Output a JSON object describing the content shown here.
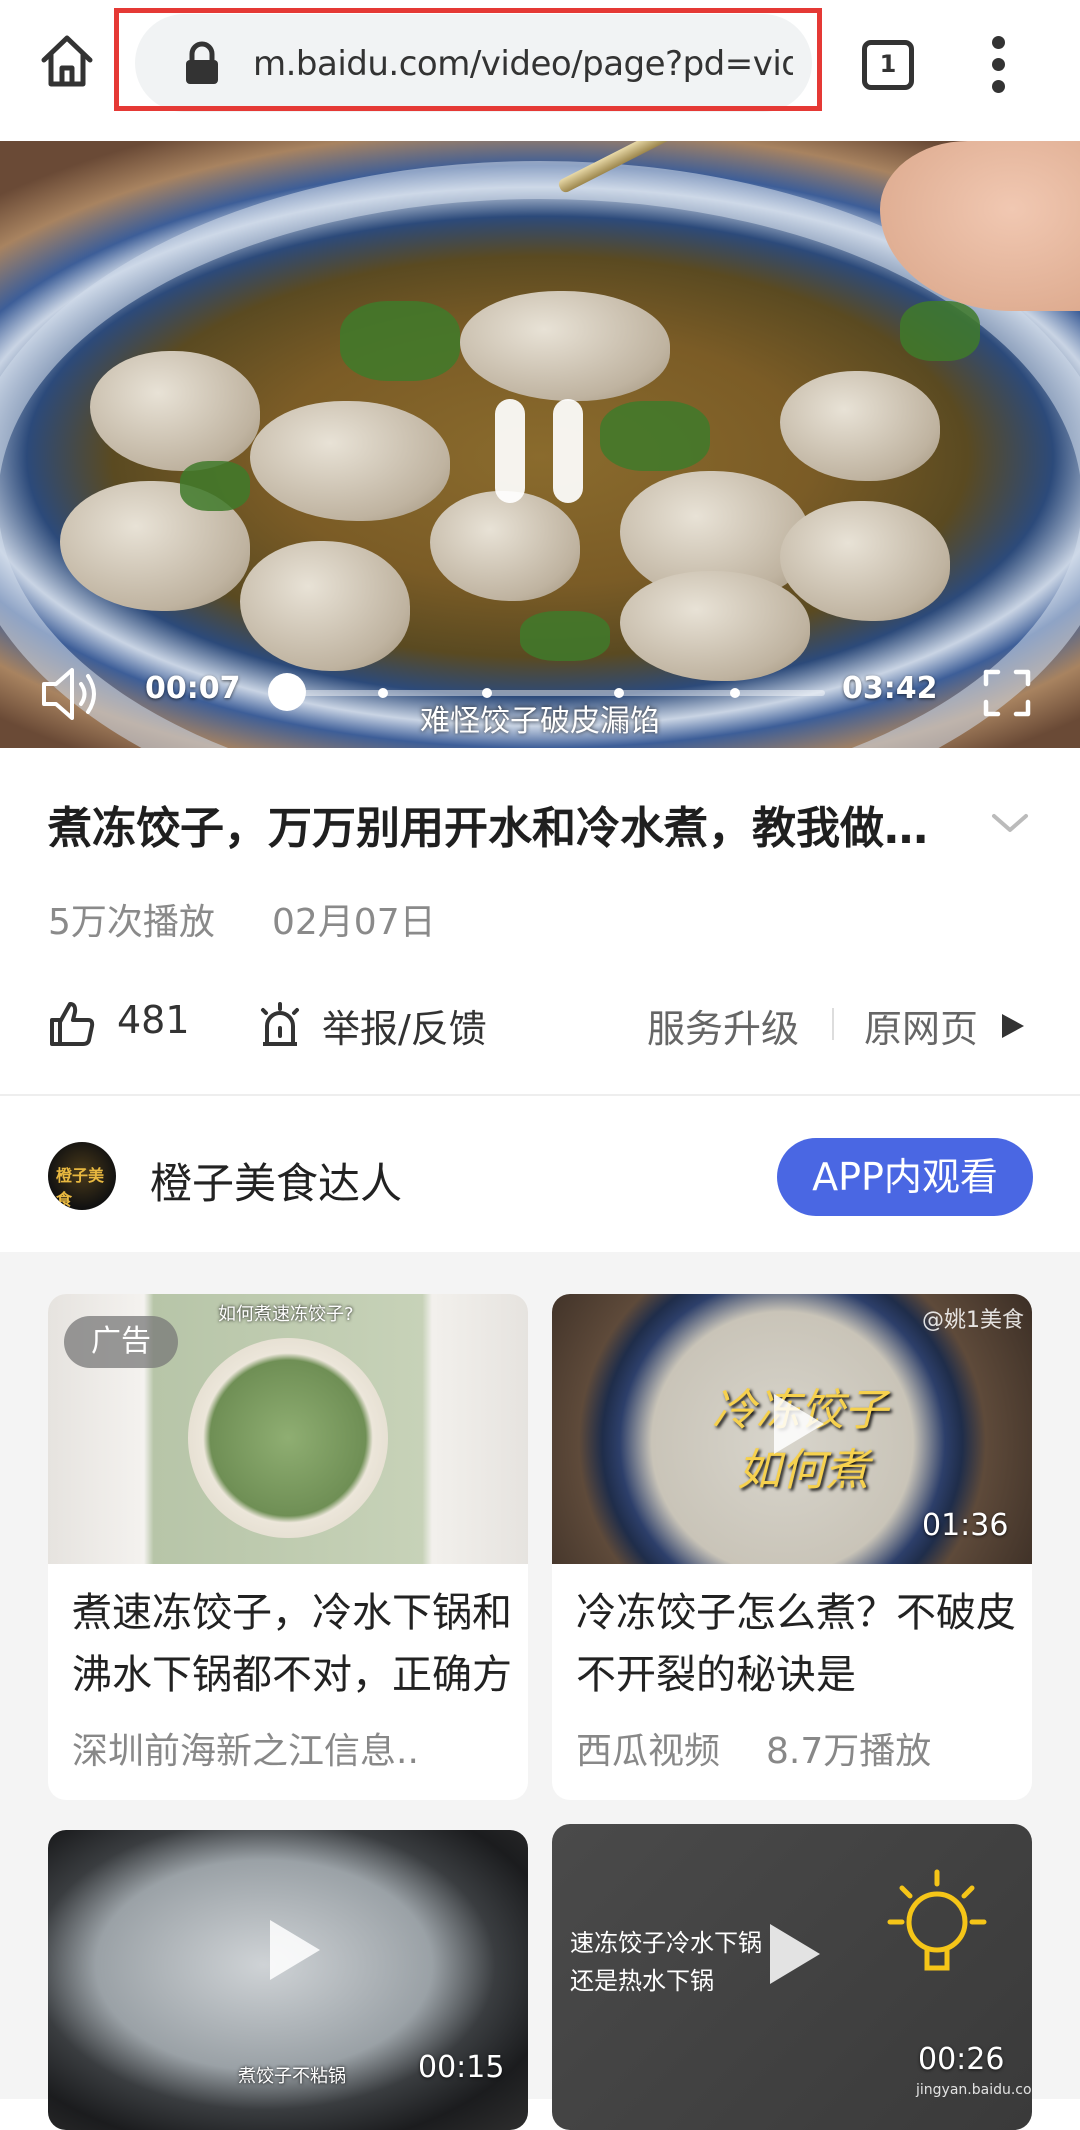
{
  "browser": {
    "url": "m.baidu.com/video/page?pd=video_page&nid=",
    "tab_count": "1",
    "icons": {
      "home": "home-icon",
      "lock": "lock-icon",
      "menu": "more-vertical-icon"
    },
    "highlight_color": "#e53935"
  },
  "player": {
    "current_time": "00:07",
    "total_time": "03:42",
    "subtitle": "难怪饺子破皮漏馅",
    "progress": 0.03,
    "icons": {
      "pause": "pause-icon",
      "volume": "volume-icon",
      "fullscreen": "fullscreen-icon"
    }
  },
  "video": {
    "title": "煮冻饺子，万万别用开水和冷水煮，教我做的是饭店大厨",
    "plays": "5万次播放",
    "date": "02月07日"
  },
  "actions": {
    "like_count": "481",
    "report_label": "举报/反馈",
    "service_label": "服务升级",
    "original_label": "原网页"
  },
  "author": {
    "name": "橙子美食达人",
    "avatar_text": "橙子美食",
    "app_button": "APP内观看",
    "accent": "#4a67e3"
  },
  "feed": [
    {
      "badge": "广告",
      "thumb_caption": "如何煮速冻饺子?",
      "title": "煮速冻饺子，冷水下锅和沸水下锅都不对，正确方法",
      "source": "深圳前海新之江信息.."
    },
    {
      "watermark": "@姚1美食",
      "thumb_text_1": "冷冻饺子",
      "thumb_text_2": "如何煮",
      "duration": "01:36",
      "title": "冷冻饺子怎么煮？不破皮不开裂的秘诀是",
      "source": "西瓜视频",
      "plays": "8.7万播放"
    },
    {
      "thumb_caption": "煮饺子不粘锅",
      "duration": "00:15"
    },
    {
      "thumb_text_1": "速冻饺子冷水下锅",
      "thumb_text_2": "还是热水下锅",
      "duration": "00:26",
      "watermark": "jingyan.baidu.com"
    }
  ]
}
